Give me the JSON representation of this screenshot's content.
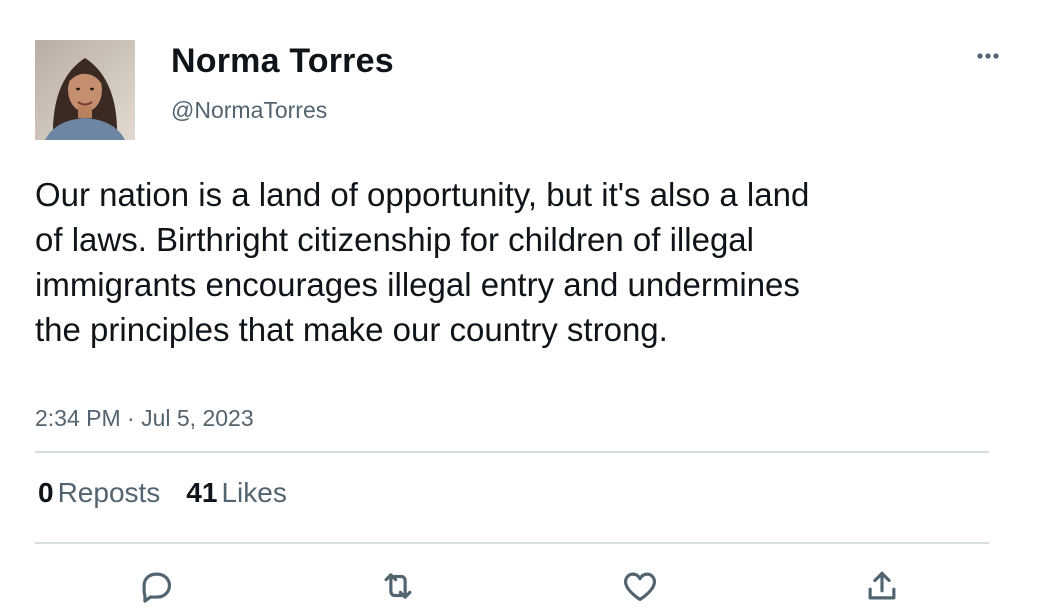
{
  "author": {
    "name": "Norma Torres",
    "handle": "@NormaTorres"
  },
  "tweet": {
    "text": "Our nation is a land of opportunity, but it's also a land of laws. Birthright citizenship for children of illegal immigrants encourages illegal entry and undermines the principles that make our country strong.",
    "timestamp": "2:34 PM · Jul 5, 2023"
  },
  "stats": {
    "reposts_count": "0",
    "reposts_label": "Reposts",
    "likes_count": "41",
    "likes_label": "Likes"
  },
  "icons": {
    "more": "more-horizontal-icon",
    "reply": "reply-icon",
    "repost": "repost-icon",
    "like": "heart-icon",
    "share": "share-icon"
  },
  "colors": {
    "text_primary": "#0f1419",
    "text_secondary": "#536471",
    "divider": "#d8dde1"
  }
}
